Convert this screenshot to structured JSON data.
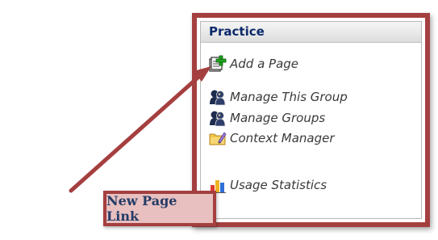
{
  "panel": {
    "title": "Practice",
    "items": [
      {
        "label": "Add a Page",
        "icon": "add-page-icon"
      },
      {
        "label": "Manage This Group",
        "icon": "group-users-icon"
      },
      {
        "label": "Manage Groups",
        "icon": "group-users-icon"
      },
      {
        "label": "Context Manager",
        "icon": "folder-edit-icon"
      },
      {
        "label": "Usage Statistics",
        "icon": "bar-chart-icon"
      }
    ]
  },
  "callout": {
    "text": "New Page Link"
  },
  "colors": {
    "frame": "#a53f3f",
    "callout_fill": "#e8c0c0",
    "callout_text": "#253b66",
    "header_text": "#0d2a6b"
  }
}
